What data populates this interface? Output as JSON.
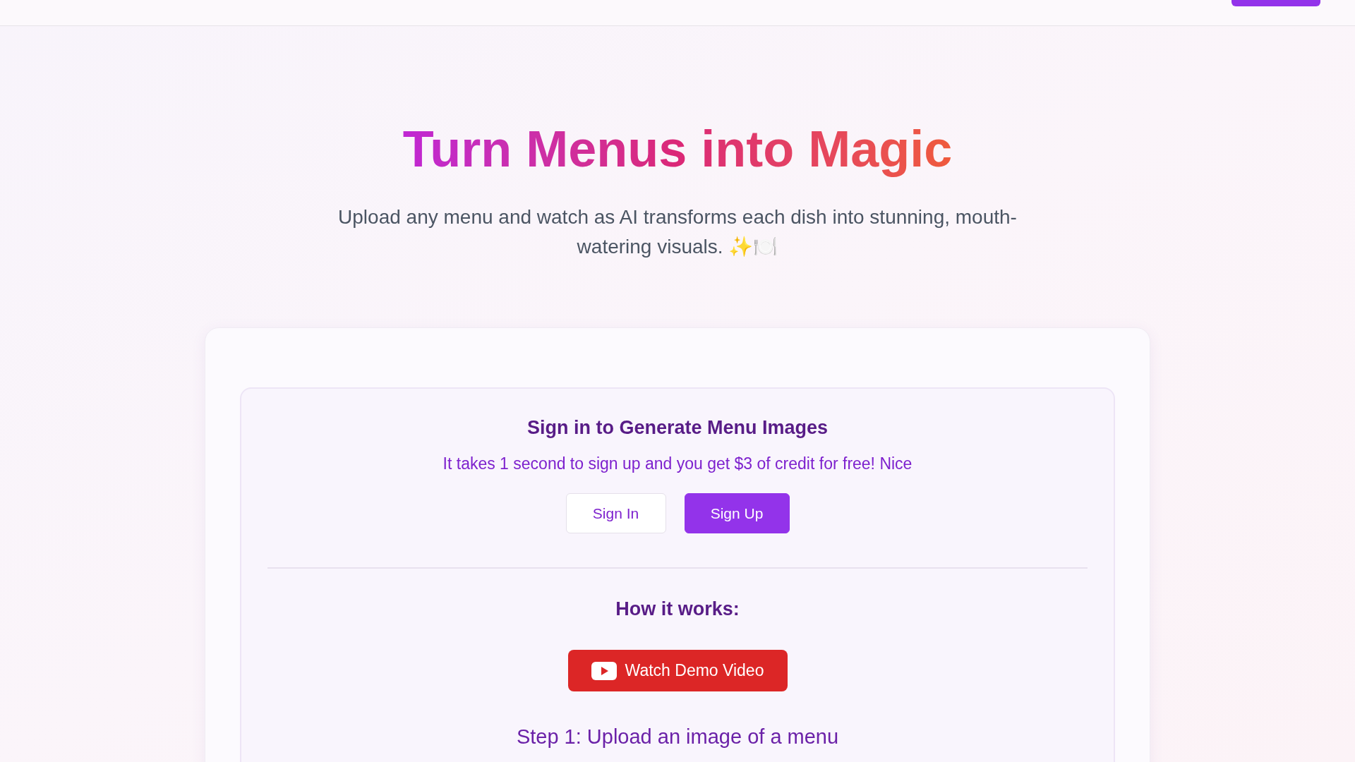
{
  "hero": {
    "title": "Turn Menus into Magic",
    "subtitle": "Upload any menu and watch as AI transforms each dish into stunning, mouth-watering visuals. ✨🍽️"
  },
  "signin": {
    "heading": "Sign in to Generate Menu Images",
    "note": "It takes 1 second to sign up and you get $3 of credit for free! Nice",
    "buttons": [
      {
        "label": "Sign In",
        "kind": "outline"
      },
      {
        "label": "Sign Up",
        "kind": "primary"
      }
    ]
  },
  "how": {
    "heading": "How it works:",
    "video_button": "Watch Demo Video",
    "step": "Step 1: Upload an image of a menu"
  }
}
